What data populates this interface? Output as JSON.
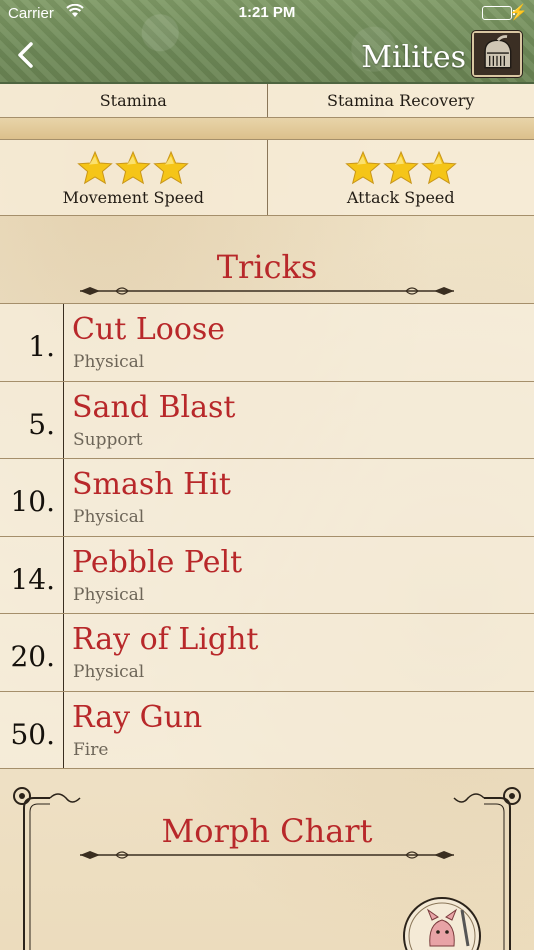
{
  "status_bar": {
    "carrier": "Carrier",
    "time": "1:21 PM"
  },
  "nav": {
    "back_icon": "chevron-left-icon",
    "title": "Milites",
    "avatar_icon": "knight-helmet-icon"
  },
  "stats": {
    "row1": [
      "Stamina",
      "Stamina Recovery"
    ],
    "row2": [
      {
        "label": "Movement Speed",
        "stars": 3,
        "max_stars": 3
      },
      {
        "label": "Attack Speed",
        "stars": 3,
        "max_stars": 3
      }
    ],
    "star_color": "#f5c518"
  },
  "tricks": {
    "title": "Tricks",
    "items": [
      {
        "level": "1.",
        "name": "Cut Loose",
        "type": "Physical"
      },
      {
        "level": "5.",
        "name": "Sand Blast",
        "type": "Support"
      },
      {
        "level": "10.",
        "name": "Smash Hit",
        "type": "Physical"
      },
      {
        "level": "14.",
        "name": "Pebble Pelt",
        "type": "Physical"
      },
      {
        "level": "20.",
        "name": "Ray of Light",
        "type": "Physical"
      },
      {
        "level": "50.",
        "name": "Ray Gun",
        "type": "Fire"
      }
    ]
  },
  "morph": {
    "title": "Morph Chart",
    "creature_icon": "pink-creature-icon"
  },
  "colors": {
    "accent_red": "#b8282a",
    "nav_green": "#6f8a58",
    "parchment": "#efe2c4"
  }
}
